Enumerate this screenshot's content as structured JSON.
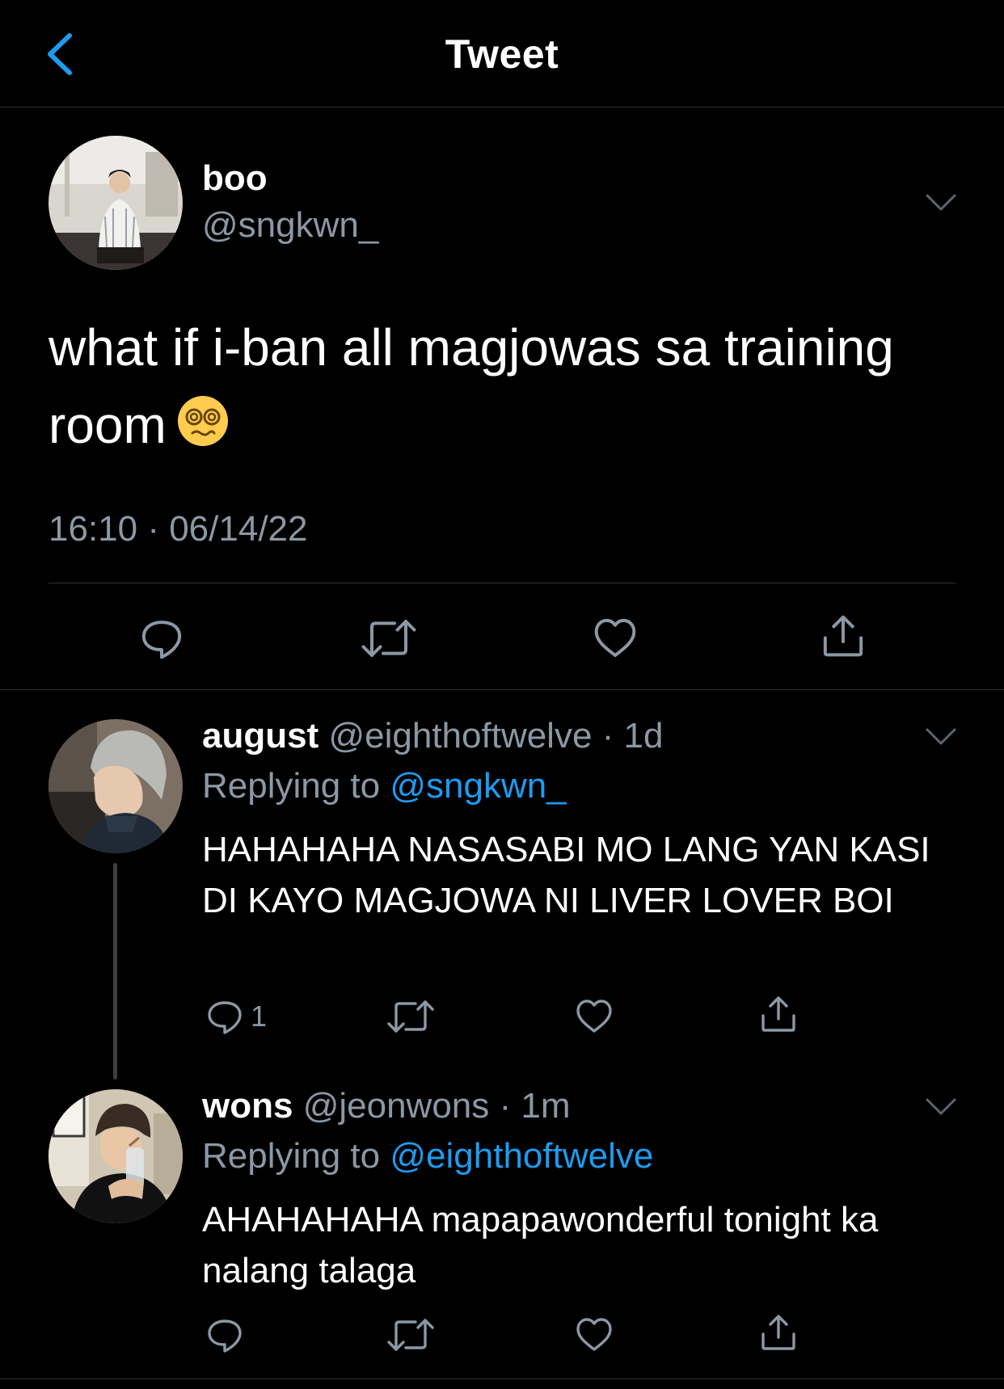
{
  "header": {
    "title": "Tweet"
  },
  "main_tweet": {
    "display_name": "boo",
    "handle": "@sngkwn_",
    "text": "what if i-ban all magjowas sa training room",
    "emoji": "dizzy-face",
    "timestamp": "16:10 · 06/14/22"
  },
  "replies": [
    {
      "display_name": "august",
      "handle": "@eighthoftwelve",
      "time": "· 1d",
      "replying_label": "Replying to",
      "replying_to": "@sngkwn_",
      "text": "HAHAHAHA NASASABI MO LANG YAN KASI DI KAYO MAGJOWA NI LIVER LOVER BOI",
      "reply_count": "1"
    },
    {
      "display_name": "wons",
      "handle": "@jeonwons",
      "time": "· 1m",
      "replying_label": "Replying to",
      "replying_to": "@eighthoftwelve",
      "text": "AHAHAHAHA mapapawonderful tonight ka nalang talaga",
      "reply_count": ""
    }
  ],
  "icons": {
    "back": "chevron-left-icon",
    "more": "chevron-down-icon",
    "reply": "speech-bubble-icon",
    "retweet": "retweet-icon",
    "like": "heart-icon",
    "share": "share-upload-icon"
  },
  "colors": {
    "background": "#000000",
    "accent": "#1d9bf0",
    "secondary_text": "#8b98a5",
    "divider": "#2f3336"
  }
}
